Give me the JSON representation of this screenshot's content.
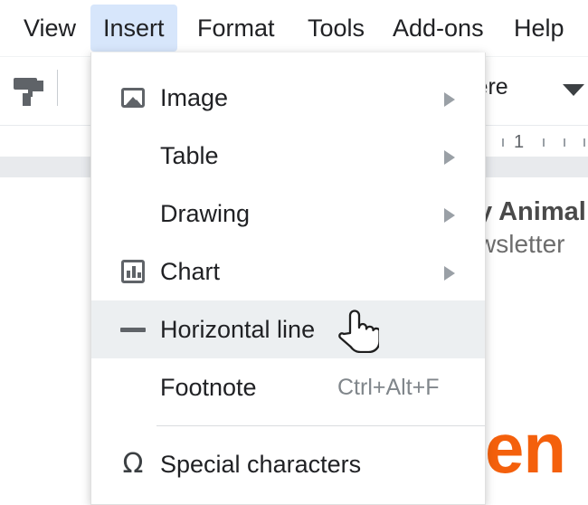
{
  "menubar": {
    "items": [
      {
        "label": "View",
        "active": false
      },
      {
        "label": "Insert",
        "active": true
      },
      {
        "label": "Format",
        "active": false
      },
      {
        "label": "Tools",
        "active": false
      },
      {
        "label": "Add-ons",
        "active": false
      },
      {
        "label": "Help",
        "active": false
      }
    ]
  },
  "toolbar": {
    "paint_format_icon": "paint-roller-icon",
    "font_name_partial": "iere",
    "font_dropdown_icon": "chevron-down-icon"
  },
  "ruler": {
    "marker_label": "1"
  },
  "document": {
    "title_partial": "y Animal",
    "subtitle_partial": "wsletter",
    "body_partial": "en"
  },
  "insert_menu": {
    "items": [
      {
        "label": "Image",
        "icon": "image-icon",
        "submenu": true,
        "shortcut": "",
        "hovered": false
      },
      {
        "label": "Table",
        "icon": "",
        "submenu": true,
        "shortcut": "",
        "hovered": false
      },
      {
        "label": "Drawing",
        "icon": "",
        "submenu": true,
        "shortcut": "",
        "hovered": false
      },
      {
        "label": "Chart",
        "icon": "chart-icon",
        "submenu": true,
        "shortcut": "",
        "hovered": false
      },
      {
        "label": "Horizontal line",
        "icon": "horizontal-line-icon",
        "submenu": false,
        "shortcut": "",
        "hovered": true
      },
      {
        "label": "Footnote",
        "icon": "",
        "submenu": false,
        "shortcut": "Ctrl+Alt+F",
        "hovered": false
      },
      {
        "label": "Special characters",
        "icon": "omega-icon",
        "submenu": false,
        "shortcut": "",
        "hovered": false
      }
    ],
    "separator_after_index": 5,
    "omega_glyph": "Ω"
  },
  "cursor": {
    "type": "pointing-hand-cursor"
  },
  "colors": {
    "menu_active_bg": "#d7e6fb",
    "row_hover_bg": "#eceff1",
    "text": "#202124",
    "muted_text": "#80868b",
    "icon": "#5f6368",
    "doc_accent": "#f4600c",
    "separator": "#dadce0"
  }
}
